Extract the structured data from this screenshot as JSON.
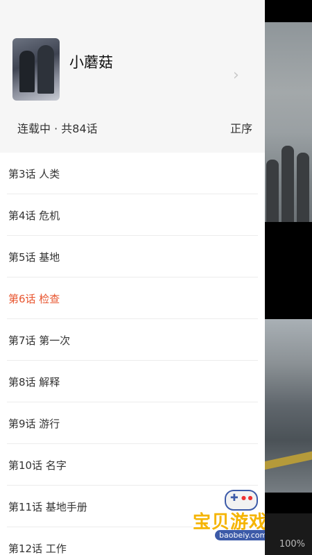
{
  "reader": {
    "zoom_label": "100%"
  },
  "drawer": {
    "comic_title": "小蘑菇",
    "status": "连载中 · 共84话",
    "sort_label": "正序",
    "chevron_icon": "chevron-right-icon",
    "active_color": "#e8552f",
    "chapters": [
      {
        "label": "第3话 人类",
        "active": false
      },
      {
        "label": "第4话 危机",
        "active": false
      },
      {
        "label": "第5话 基地",
        "active": false
      },
      {
        "label": "第6话 检查",
        "active": true
      },
      {
        "label": "第7话 第一次",
        "active": false
      },
      {
        "label": "第8话 解释",
        "active": false
      },
      {
        "label": "第9话 游行",
        "active": false
      },
      {
        "label": "第10话 名字",
        "active": false
      },
      {
        "label": "第11话 基地手册",
        "active": false
      },
      {
        "label": "第12话 工作",
        "active": false
      }
    ]
  },
  "watermark": {
    "text": "宝贝游戏网",
    "url": "baobeiy.com",
    "icon": "gamepad-icon"
  }
}
